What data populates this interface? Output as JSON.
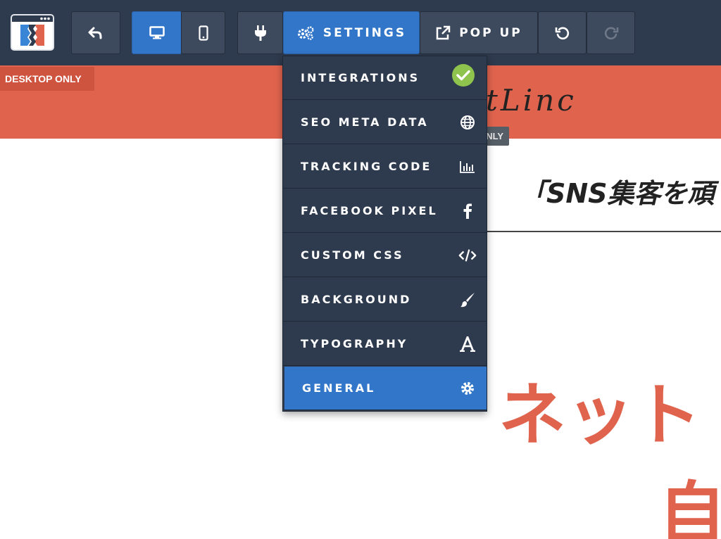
{
  "toolbar": {
    "settings_label": "SETTINGS",
    "popup_label": "POP UP"
  },
  "icons": {
    "back": "back-arrow-icon",
    "desktop": "desktop-icon",
    "mobile": "mobile-icon",
    "plugin": "plug-icon",
    "settings": "gears-icon",
    "popup": "external-link-icon",
    "undo": "undo-icon",
    "redo": "redo-icon"
  },
  "page": {
    "desktop_badge": "DESKTOP ONLY",
    "only_badge": "NLY",
    "logo_script": "tLinc",
    "heading": "「SNS集客を頑",
    "big_text_line1": "ネット",
    "big_text_line2": "自"
  },
  "dropdown": {
    "items": [
      {
        "label": "INTEGRATIONS",
        "icon": "check-icon"
      },
      {
        "label": "SEO META DATA",
        "icon": "globe-icon"
      },
      {
        "label": "TRACKING CODE",
        "icon": "bar-chart-icon"
      },
      {
        "label": "FACEBOOK PIXEL",
        "icon": "facebook-icon"
      },
      {
        "label": "CUSTOM CSS",
        "icon": "code-icon"
      },
      {
        "label": "BACKGROUND",
        "icon": "brush-icon"
      },
      {
        "label": "TYPOGRAPHY",
        "icon": "font-icon"
      },
      {
        "label": "GENERAL",
        "icon": "gear-icon"
      }
    ]
  },
  "colors": {
    "toolbar_bg": "#2e3a4d",
    "accent_blue": "#3276c9",
    "brand_coral": "#e0644d",
    "check_green": "#8ec34d"
  }
}
